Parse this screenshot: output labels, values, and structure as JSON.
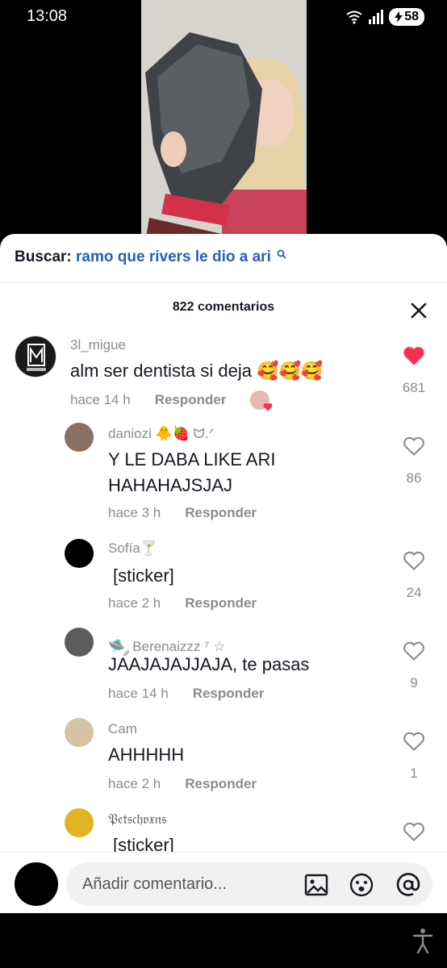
{
  "status_bar": {
    "time": "13:08",
    "battery": "58"
  },
  "search": {
    "label": "Buscar:",
    "query": "ramo que rivers le dio a ari"
  },
  "comments_header": "822 comentarios",
  "comments": [
    {
      "username": "3l_migue",
      "text": "alm ser dentista si deja 🥰🥰🥰",
      "time": "hace 14 h",
      "reply_label": "Responder",
      "likes": "681",
      "liked": true
    },
    {
      "username": "daniozi 🐥🍓 ᗢ.ᐟ",
      "text_line1": "Y LE DABA LIKE ARI",
      "text_line2": "HAHAHAJSJAJ",
      "time": "hace 3 h",
      "reply_label": "Responder",
      "likes": "86"
    },
    {
      "username": "Sofía🍸",
      "text": "[sticker]",
      "time": "hace 2 h",
      "reply_label": "Responder",
      "likes": "24"
    },
    {
      "username": "🛸 ༘ Berenaizzz ⁷ ☆",
      "text": "JAAJAJAJJAJA, te pasas",
      "time": "hace 14 h",
      "reply_label": "Responder",
      "likes": "9"
    },
    {
      "username": "Cam",
      "text": "AHHHHH",
      "time": "hace 2 h",
      "reply_label": "Responder",
      "likes": "1"
    },
    {
      "username": "𝔓𝔢𝔱𝔰𝔠𝔥𝔳𝔵𝔫𝔰",
      "text": "[sticker]"
    }
  ],
  "input": {
    "placeholder": "Añadir comentario..."
  },
  "colors": {
    "accent_link": "#2b5db6",
    "like_red": "#fe2c55",
    "muted_text": "#8a8b91"
  }
}
